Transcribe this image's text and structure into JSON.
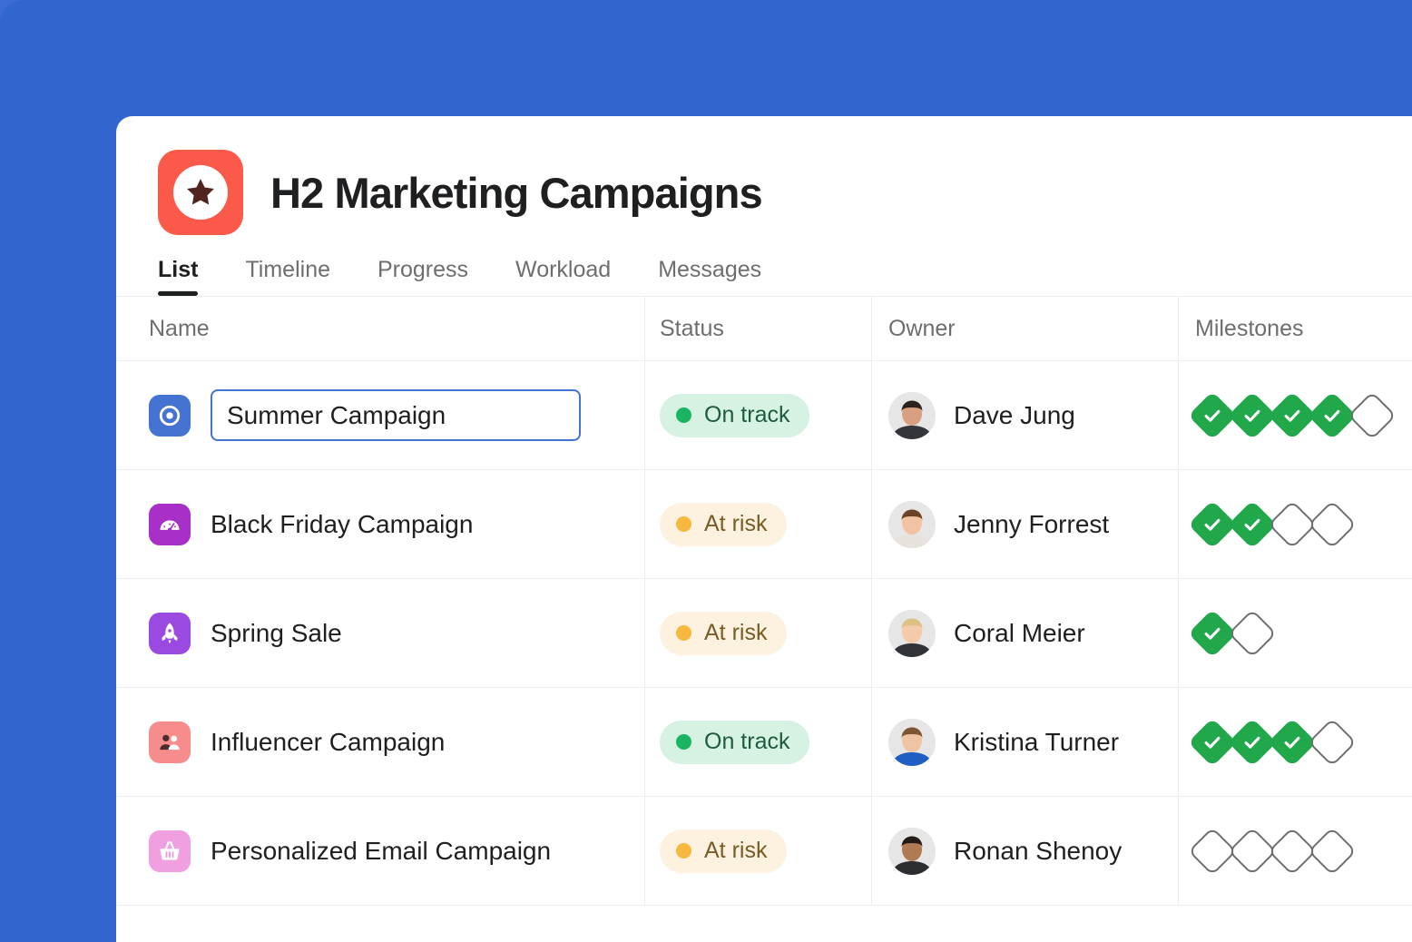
{
  "theme": {
    "background_blue": "#3266cf",
    "card_background": "#ffffff",
    "project_icon_color": "#fb5a4b",
    "accent_blue": "#4573d2",
    "status_green": "#1ab463",
    "status_amber": "#f6b93e",
    "milestone_green": "#21a84b"
  },
  "header": {
    "icon_name": "star-icon",
    "title": "H2 Marketing Campaigns"
  },
  "tabs": [
    {
      "label": "List",
      "active": true
    },
    {
      "label": "Timeline",
      "active": false
    },
    {
      "label": "Progress",
      "active": false
    },
    {
      "label": "Workload",
      "active": false
    },
    {
      "label": "Messages",
      "active": false
    }
  ],
  "table": {
    "columns": [
      {
        "key": "name",
        "label": "Name"
      },
      {
        "key": "status",
        "label": "Status"
      },
      {
        "key": "owner",
        "label": "Owner"
      },
      {
        "key": "milestones",
        "label": "Milestones"
      }
    ],
    "rows": [
      {
        "name": "Summer Campaign",
        "editing": true,
        "icon": "target-icon",
        "icon_color": "#4573d2",
        "status": "On track",
        "status_type": "ontrack",
        "owner": "Dave Jung",
        "avatar": "avatar-dave-jung",
        "milestones_total": 5,
        "milestones_done": 4
      },
      {
        "name": "Black Friday Campaign",
        "editing": false,
        "icon": "speedometer-icon",
        "icon_color": "#a830c8",
        "status": "At risk",
        "status_type": "atrisk",
        "owner": "Jenny Forrest",
        "avatar": "avatar-jenny-forrest",
        "milestones_total": 4,
        "milestones_done": 2
      },
      {
        "name": "Spring Sale",
        "editing": false,
        "icon": "rocket-icon",
        "icon_color": "#9a4ae0",
        "status": "At risk",
        "status_type": "atrisk",
        "owner": "Coral Meier",
        "avatar": "avatar-coral-meier",
        "milestones_total": 2,
        "milestones_done": 1
      },
      {
        "name": "Influencer Campaign",
        "editing": false,
        "icon": "people-icon",
        "icon_color": "#f78c8c",
        "status": "On track",
        "status_type": "ontrack",
        "owner": "Kristina Turner",
        "avatar": "avatar-kristina-turner",
        "milestones_total": 4,
        "milestones_done": 3
      },
      {
        "name": "Personalized Email Campaign",
        "editing": false,
        "icon": "shopping-basket-icon",
        "icon_color": "#f09fe0",
        "status": "At risk",
        "status_type": "atrisk",
        "owner": "Ronan Shenoy",
        "avatar": "avatar-ronan-shenoy",
        "milestones_total": 4,
        "milestones_done": 0
      }
    ]
  }
}
